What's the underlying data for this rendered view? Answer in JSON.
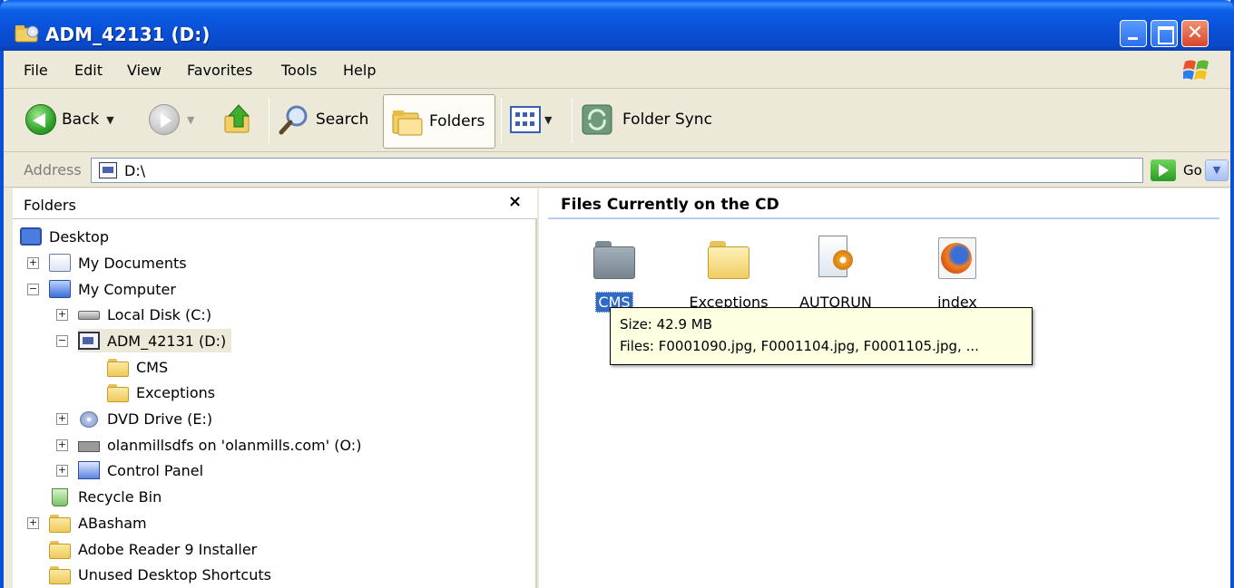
{
  "window": {
    "title": "ADM_42131 (D:)"
  },
  "menu": {
    "items": [
      "File",
      "Edit",
      "View",
      "Favorites",
      "Tools",
      "Help"
    ]
  },
  "toolbar": {
    "back_label": "Back",
    "search_label": "Search",
    "folders_label": "Folders",
    "folder_sync_label": "Folder Sync"
  },
  "address": {
    "label": "Address",
    "value": "D:\\",
    "go_label": "Go"
  },
  "folders_pane": {
    "title": "Folders",
    "close_glyph": "×",
    "tree": [
      {
        "label": "Desktop",
        "icon": "desktop-icon"
      },
      {
        "label": "My Documents",
        "icon": "my-documents-icon",
        "expander": "+"
      },
      {
        "label": "My Computer",
        "icon": "my-computer-icon",
        "expander": "−"
      },
      {
        "label": "Local Disk (C:)",
        "icon": "hard-disk-icon",
        "expander": "+"
      },
      {
        "label": "ADM_42131 (D:)",
        "icon": "cd-drive-icon",
        "expander": "−",
        "selected": true
      },
      {
        "label": "CMS",
        "icon": "folder-icon"
      },
      {
        "label": "Exceptions",
        "icon": "folder-icon"
      },
      {
        "label": "DVD Drive (E:)",
        "icon": "dvd-drive-icon",
        "expander": "+"
      },
      {
        "label": "olanmillsdfs on 'olanmills.com' (O:)",
        "icon": "network-drive-icon",
        "expander": "+"
      },
      {
        "label": "Control Panel",
        "icon": "control-panel-icon",
        "expander": "+"
      },
      {
        "label": "Recycle Bin",
        "icon": "recycle-bin-icon"
      },
      {
        "label": "ABasham",
        "icon": "folder-icon",
        "expander": "+"
      },
      {
        "label": "Adobe Reader 9 Installer",
        "icon": "folder-icon"
      },
      {
        "label": "Unused Desktop Shortcuts",
        "icon": "folder-icon"
      }
    ]
  },
  "content": {
    "title": "Files Currently on the CD",
    "items": [
      {
        "label": "CMS",
        "icon": "folder-gray-icon",
        "selected": true
      },
      {
        "label": "Exceptions",
        "icon": "folder-icon"
      },
      {
        "label": "AUTORUN",
        "icon": "autorun-file-icon"
      },
      {
        "label": "index",
        "icon": "firefox-html-icon"
      }
    ]
  },
  "tooltip": {
    "size": "Size: 42.9 MB",
    "files": "Files: F0001090.jpg, F0001104.jpg, F0001105.jpg, ..."
  },
  "colors": {
    "titlebar": "#0a50d6",
    "selection": "#316ac5",
    "chrome": "#ece9d8",
    "tooltip_bg": "#ffffe1"
  }
}
